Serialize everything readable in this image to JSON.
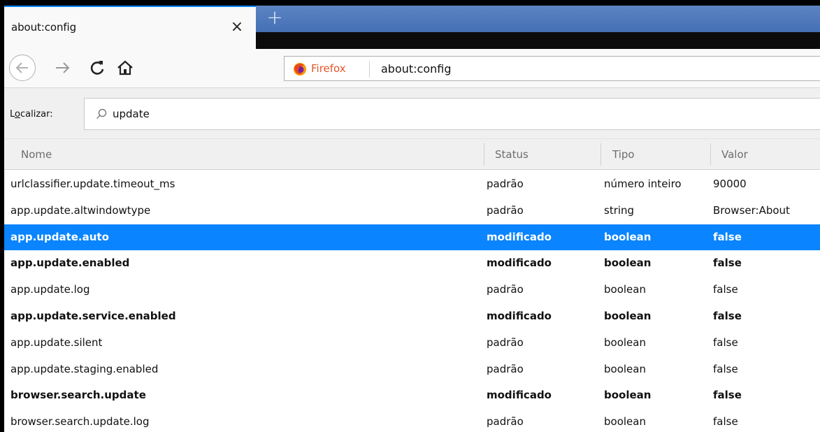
{
  "tab": {
    "title": "about:config",
    "close": "×",
    "new_tab": "+"
  },
  "nav": {
    "identity_label": "Firefox",
    "url": "about:config"
  },
  "search": {
    "label_prefix": "L",
    "label_accel": "o",
    "label_rest": "calizar:",
    "value": "update"
  },
  "table": {
    "headers": {
      "name": "Nome",
      "status": "Status",
      "type": "Tipo",
      "value": "Valor"
    },
    "rows": [
      {
        "name": "urlclassifier.update.timeout_ms",
        "status": "padrão",
        "type": "número inteiro",
        "value": "90000",
        "modified": false,
        "selected": false
      },
      {
        "name": "app.update.altwindowtype",
        "status": "padrão",
        "type": "string",
        "value": "Browser:About",
        "modified": false,
        "selected": false
      },
      {
        "name": "app.update.auto",
        "status": "modificado",
        "type": "boolean",
        "value": "false",
        "modified": true,
        "selected": true
      },
      {
        "name": "app.update.enabled",
        "status": "modificado",
        "type": "boolean",
        "value": "false",
        "modified": true,
        "selected": false
      },
      {
        "name": "app.update.log",
        "status": "padrão",
        "type": "boolean",
        "value": "false",
        "modified": false,
        "selected": false
      },
      {
        "name": "app.update.service.enabled",
        "status": "modificado",
        "type": "boolean",
        "value": "false",
        "modified": true,
        "selected": false
      },
      {
        "name": "app.update.silent",
        "status": "padrão",
        "type": "boolean",
        "value": "false",
        "modified": false,
        "selected": false
      },
      {
        "name": "app.update.staging.enabled",
        "status": "padrão",
        "type": "boolean",
        "value": "false",
        "modified": false,
        "selected": false
      },
      {
        "name": "browser.search.update",
        "status": "modificado",
        "type": "boolean",
        "value": "false",
        "modified": true,
        "selected": false
      },
      {
        "name": "browser.search.update.log",
        "status": "padrão",
        "type": "boolean",
        "value": "false",
        "modified": false,
        "selected": false
      }
    ]
  },
  "colors": {
    "selection": "#0a84ff",
    "tabstrip": "#4f7bbd",
    "firefox_label": "#e1562b"
  }
}
